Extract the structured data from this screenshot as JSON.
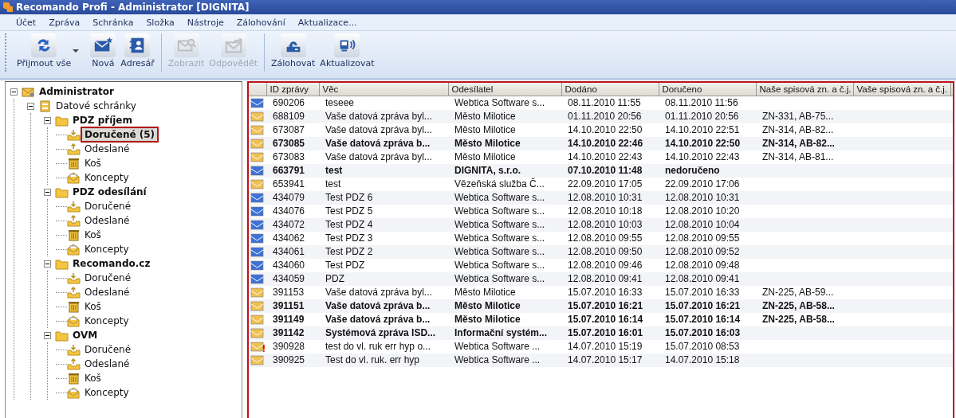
{
  "window": {
    "title": "Recomando Profi - Administrator [DIGNITA]"
  },
  "menu": [
    "Účet",
    "Zpráva",
    "Schránka",
    "Složka",
    "Nástroje",
    "Zálohování",
    "Aktualizace..."
  ],
  "toolbar": {
    "groups": [
      {
        "buttons": [
          {
            "label": "Přijmout vše",
            "kind": "sync",
            "disabled": false,
            "dropdown": true
          },
          {
            "label": "Nová",
            "kind": "new",
            "disabled": false,
            "dropdown": false
          },
          {
            "label": "Adresář",
            "kind": "contacts",
            "disabled": false,
            "dropdown": false
          }
        ]
      },
      {
        "buttons": [
          {
            "label": "Zobrazit",
            "kind": "view",
            "disabled": true,
            "dropdown": false
          },
          {
            "label": "Odpovědět",
            "kind": "reply",
            "disabled": true,
            "dropdown": false
          }
        ]
      },
      {
        "buttons": [
          {
            "label": "Zálohovat",
            "kind": "backup",
            "disabled": false,
            "dropdown": false
          },
          {
            "label": "Aktualizovat",
            "kind": "update",
            "disabled": false,
            "dropdown": false
          }
        ]
      }
    ]
  },
  "tree": [
    {
      "label": "Administrator",
      "kind": "account",
      "expanded": true,
      "selected": false,
      "children": [
        {
          "label": "Datové schránky",
          "kind": "group",
          "expanded": true,
          "selected": false,
          "children": [
            {
              "label": "PDZ příjem",
              "kind": "folder",
              "expanded": true,
              "selected": false,
              "children": [
                {
                  "label": "Doručené (5)",
                  "kind": "inbox",
                  "selected": true
                },
                {
                  "label": "Odeslané",
                  "kind": "outbox",
                  "selected": false
                },
                {
                  "label": "Koš",
                  "kind": "trash",
                  "selected": false
                },
                {
                  "label": "Koncepty",
                  "kind": "drafts",
                  "selected": false
                }
              ]
            },
            {
              "label": "PDZ odesílání",
              "kind": "folder",
              "expanded": true,
              "selected": false,
              "children": [
                {
                  "label": "Doručené",
                  "kind": "inbox",
                  "selected": false
                },
                {
                  "label": "Odeslané",
                  "kind": "outbox",
                  "selected": false
                },
                {
                  "label": "Koš",
                  "kind": "trash",
                  "selected": false
                },
                {
                  "label": "Koncepty",
                  "kind": "drafts",
                  "selected": false
                }
              ]
            },
            {
              "label": "Recomando.cz",
              "kind": "folder",
              "expanded": true,
              "selected": false,
              "children": [
                {
                  "label": "Doručené",
                  "kind": "inbox",
                  "selected": false
                },
                {
                  "label": "Odeslané",
                  "kind": "outbox",
                  "selected": false
                },
                {
                  "label": "Koš",
                  "kind": "trash",
                  "selected": false
                },
                {
                  "label": "Koncepty",
                  "kind": "drafts",
                  "selected": false
                }
              ]
            },
            {
              "label": "OVM",
              "kind": "folder",
              "expanded": true,
              "selected": false,
              "children": [
                {
                  "label": "Doručené",
                  "kind": "inbox",
                  "selected": false
                },
                {
                  "label": "Odeslané",
                  "kind": "outbox",
                  "selected": false
                },
                {
                  "label": "Koš",
                  "kind": "trash",
                  "selected": false
                },
                {
                  "label": "Koncepty",
                  "kind": "drafts",
                  "selected": false
                }
              ]
            }
          ]
        }
      ]
    }
  ],
  "table": {
    "columns": [
      "ID zprávy",
      "Věc",
      "Odesílatel",
      "Dodáno",
      "Doručeno",
      "Naše spisová zn. a č.j.",
      "Vaše spisová zn. a č.j."
    ],
    "rows": [
      {
        "color": "#3d72d6",
        "unread": false,
        "flag": false,
        "cells": [
          "690206",
          "teseee",
          "Webtica Software s...",
          "08.11.2010 11:55",
          "08.11.2010 11:56",
          "",
          ""
        ]
      },
      {
        "color": "#f0c050",
        "unread": false,
        "flag": false,
        "cells": [
          "688109",
          "Vaše datová zpráva byl...",
          "Město Milotice",
          "01.11.2010 20:56",
          "01.11.2010 20:56",
          "ZN-331, AB-75...",
          ""
        ]
      },
      {
        "color": "#f0c050",
        "unread": false,
        "flag": false,
        "cells": [
          "673087",
          "Vaše datová zpráva byl...",
          "Město Milotice",
          "14.10.2010 22:50",
          "14.10.2010 22:51",
          "ZN-314, AB-82...",
          ""
        ]
      },
      {
        "color": "#f0c050",
        "unread": true,
        "flag": false,
        "cells": [
          "673085",
          "Vaše datová zpráva b...",
          "Město Milotice",
          "14.10.2010 22:46",
          "14.10.2010 22:50",
          "ZN-314, AB-82...",
          ""
        ]
      },
      {
        "color": "#f0c050",
        "unread": false,
        "flag": false,
        "cells": [
          "673083",
          "Vaše datová zpráva byl...",
          "Město Milotice",
          "14.10.2010 22:43",
          "14.10.2010 22:43",
          "ZN-314, AB-81...",
          ""
        ]
      },
      {
        "color": "#3d72d6",
        "unread": true,
        "flag": false,
        "cells": [
          "663791",
          "test",
          "DIGNITA, s.r.o.",
          "07.10.2010 11:48",
          "nedoručeno",
          "",
          ""
        ]
      },
      {
        "color": "#f0c050",
        "unread": false,
        "flag": false,
        "cells": [
          "653941",
          "test",
          "Vězeňská služba Č...",
          "22.09.2010 17:05",
          "22.09.2010 17:06",
          "",
          ""
        ]
      },
      {
        "color": "#3d72d6",
        "unread": false,
        "flag": false,
        "cells": [
          "434079",
          "Test PDZ 6",
          "Webtica Software s...",
          "12.08.2010 10:31",
          "12.08.2010 10:31",
          "",
          ""
        ]
      },
      {
        "color": "#3d72d6",
        "unread": false,
        "flag": false,
        "cells": [
          "434076",
          "Test PDZ 5",
          "Webtica Software s...",
          "12.08.2010 10:18",
          "12.08.2010 10:20",
          "",
          ""
        ]
      },
      {
        "color": "#3d72d6",
        "unread": false,
        "flag": false,
        "cells": [
          "434072",
          "Test PDZ 4",
          "Webtica Software s...",
          "12.08.2010 10:03",
          "12.08.2010 10:04",
          "",
          ""
        ]
      },
      {
        "color": "#3d72d6",
        "unread": false,
        "flag": false,
        "cells": [
          "434062",
          "Test PDZ 3",
          "Webtica Software s...",
          "12.08.2010 09:55",
          "12.08.2010 09:55",
          "",
          ""
        ]
      },
      {
        "color": "#3d72d6",
        "unread": false,
        "flag": false,
        "cells": [
          "434061",
          "Test PDZ 2",
          "Webtica Software s...",
          "12.08.2010 09:50",
          "12.08.2010 09:52",
          "",
          ""
        ]
      },
      {
        "color": "#3d72d6",
        "unread": false,
        "flag": false,
        "cells": [
          "434060",
          "Test PDZ",
          "Webtica Software s...",
          "12.08.2010 09:46",
          "12.08.2010 09:48",
          "",
          ""
        ]
      },
      {
        "color": "#3d72d6",
        "unread": false,
        "flag": false,
        "cells": [
          "434059",
          "PDZ",
          "Webtica Software s...",
          "12.08.2010 09:41",
          "12.08.2010 09:41",
          "",
          ""
        ]
      },
      {
        "color": "#f0c050",
        "unread": false,
        "flag": false,
        "cells": [
          "391153",
          "Vaše datová zpráva byl...",
          "Město Milotice",
          "15.07.2010 16:33",
          "15.07.2010 16:33",
          "ZN-225, AB-59...",
          ""
        ]
      },
      {
        "color": "#f0c050",
        "unread": true,
        "flag": false,
        "cells": [
          "391151",
          "Vaše datová zpráva b...",
          "Město Milotice",
          "15.07.2010 16:21",
          "15.07.2010 16:21",
          "ZN-225, AB-58...",
          ""
        ]
      },
      {
        "color": "#f0c050",
        "unread": true,
        "flag": false,
        "cells": [
          "391149",
          "Vaše datová zpráva b...",
          "Město Milotice",
          "15.07.2010 16:14",
          "15.07.2010 16:14",
          "ZN-225, AB-58...",
          ""
        ]
      },
      {
        "color": "#f0c050",
        "unread": true,
        "flag": false,
        "cells": [
          "391142",
          "Systémová zpráva ISD...",
          "Informační systém...",
          "15.07.2010 16:01",
          "15.07.2010 16:03",
          "",
          ""
        ]
      },
      {
        "color": "#f0c050",
        "unread": false,
        "flag": true,
        "cells": [
          "390928",
          "test do vl. ruk err hyp o...",
          "Webtica Software ...",
          "14.07.2010 15:19",
          "15.07.2010 08:53",
          "",
          ""
        ]
      },
      {
        "color": "#f0c050",
        "unread": false,
        "flag": false,
        "cells": [
          "390925",
          "Test do vl. ruk. err hyp",
          "Webtica Software ...",
          "14.07.2010 15:17",
          "14.07.2010 15:18",
          "",
          ""
        ]
      }
    ]
  }
}
